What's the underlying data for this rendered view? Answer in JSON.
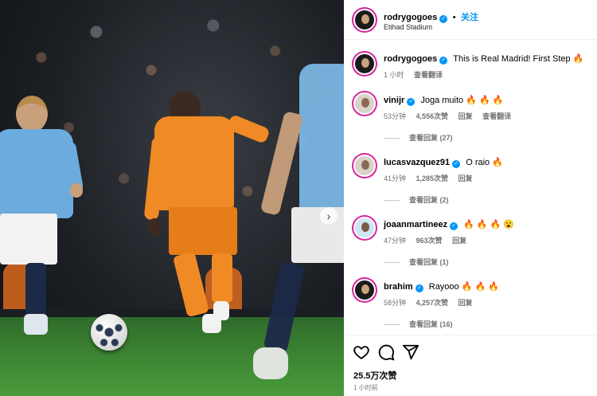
{
  "post": {
    "username": "rodrygogoes",
    "follow_label": "关注",
    "location": "Etihad Stadium",
    "icons": {
      "verified": "verified-badge-icon",
      "next": "chevron-right-icon",
      "like": "heart-icon",
      "comment": "comment-bubble-icon",
      "share": "paper-plane-icon"
    }
  },
  "caption": {
    "username": "rodrygogoes",
    "text": "This is Real Madrid! First Step 🔥",
    "time": "1 小时",
    "translate": "查看翻译"
  },
  "comments": [
    {
      "username": "vinijr",
      "text": "Joga muito 🔥 🔥 🔥",
      "time": "53分钟",
      "likes": "4,556次赞",
      "reply": "回复",
      "translate": "查看翻译",
      "view_replies": "查看回复 (27)"
    },
    {
      "username": "lucasvazquez91",
      "text": "O raio 🔥",
      "time": "41分钟",
      "likes": "1,285次赞",
      "reply": "回复",
      "view_replies": "查看回复 (2)"
    },
    {
      "username": "joaanmartineez",
      "text": "🔥 🔥 🔥 😮",
      "time": "47分钟",
      "likes": "963次赞",
      "reply": "回复",
      "view_replies": "查看回复 (1)"
    },
    {
      "username": "brahim",
      "text": "Rayooo 🔥 🔥 🔥",
      "time": "58分钟",
      "likes": "4,257次赞",
      "reply": "回复",
      "view_replies": "查看回复 (16)"
    }
  ],
  "footer": {
    "likes": "25.5万次赞",
    "time": "1 小时前"
  },
  "colors": {
    "accent": "#0095f6",
    "muted": "#737373",
    "madrid_kit": "#f08a24",
    "city_kit": "#6cabdd"
  }
}
